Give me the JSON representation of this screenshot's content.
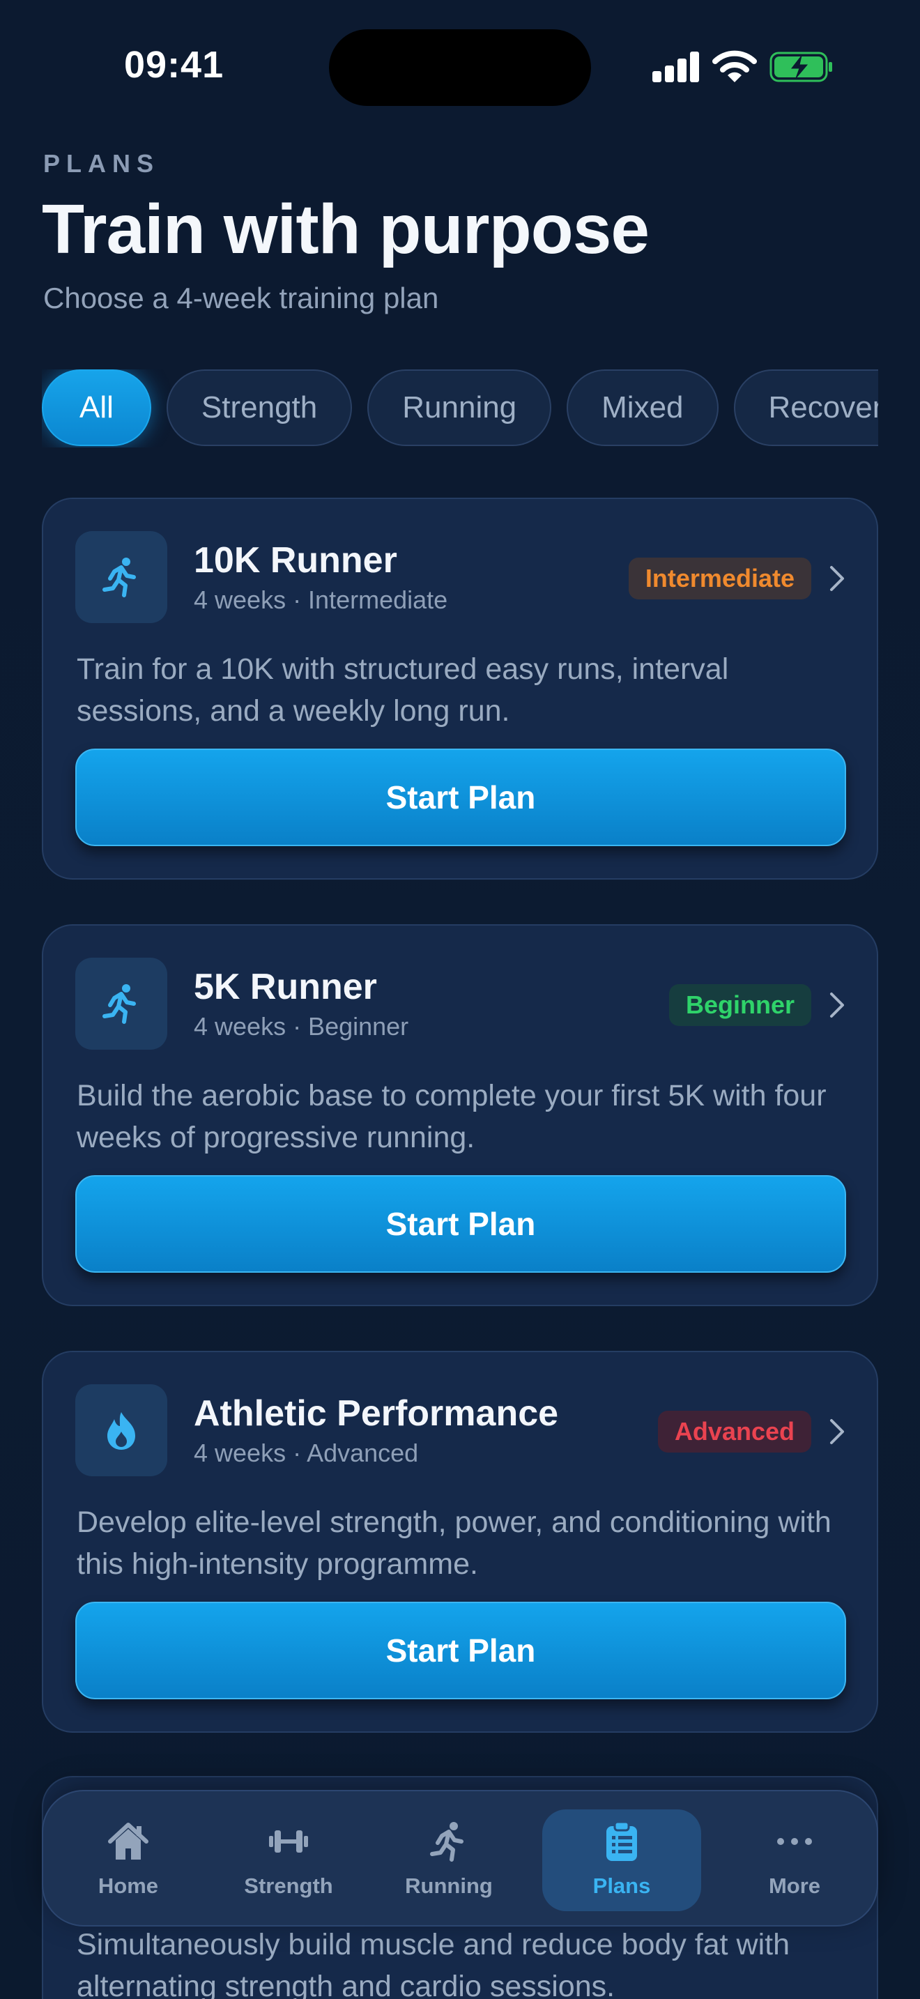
{
  "status_bar": {
    "time": "09:41"
  },
  "header": {
    "eyebrow": "PLANS",
    "title": "Train with purpose",
    "subtitle": "Choose a 4-week training plan"
  },
  "filters": [
    {
      "label": "All",
      "active": true
    },
    {
      "label": "Strength",
      "active": false
    },
    {
      "label": "Running",
      "active": false
    },
    {
      "label": "Mixed",
      "active": false
    },
    {
      "label": "Recovery",
      "active": false
    }
  ],
  "plans": [
    {
      "name": "10K Runner",
      "meta": "4 weeks · Intermediate",
      "level": "Intermediate",
      "icon": "runner-icon",
      "description": "Train for a 10K with structured easy runs, interval sessions, and a weekly long run.",
      "cta": "Start Plan"
    },
    {
      "name": "5K Runner",
      "meta": "4 weeks · Beginner",
      "level": "Beginner",
      "icon": "runner-icon",
      "description": "Build the aerobic base to complete your first 5K with four weeks of progressive running.",
      "cta": "Start Plan"
    },
    {
      "name": "Athletic Performance",
      "meta": "4 weeks · Advanced",
      "level": "Advanced",
      "icon": "flame-icon",
      "description": "Develop elite-level strength, power, and conditioning with this high-intensity programme.",
      "cta": "Start Plan"
    },
    {
      "description": "Simultaneously build muscle and reduce body fat with alternating strength and cardio sessions."
    }
  ],
  "tab_bar": [
    {
      "label": "Home",
      "icon": "home-icon",
      "active": false
    },
    {
      "label": "Strength",
      "icon": "dumbbell-icon",
      "active": false
    },
    {
      "label": "Running",
      "icon": "runner-icon",
      "active": false
    },
    {
      "label": "Plans",
      "icon": "clipboard-icon",
      "active": true
    },
    {
      "label": "More",
      "icon": "more-icon",
      "active": false
    }
  ],
  "colors": {
    "accent": "#14a4ec",
    "background": "#0c1a2f",
    "card": "#15294a",
    "intermediate": "#f08a2e",
    "beginner": "#2fd36a",
    "advanced": "#ea4350"
  }
}
